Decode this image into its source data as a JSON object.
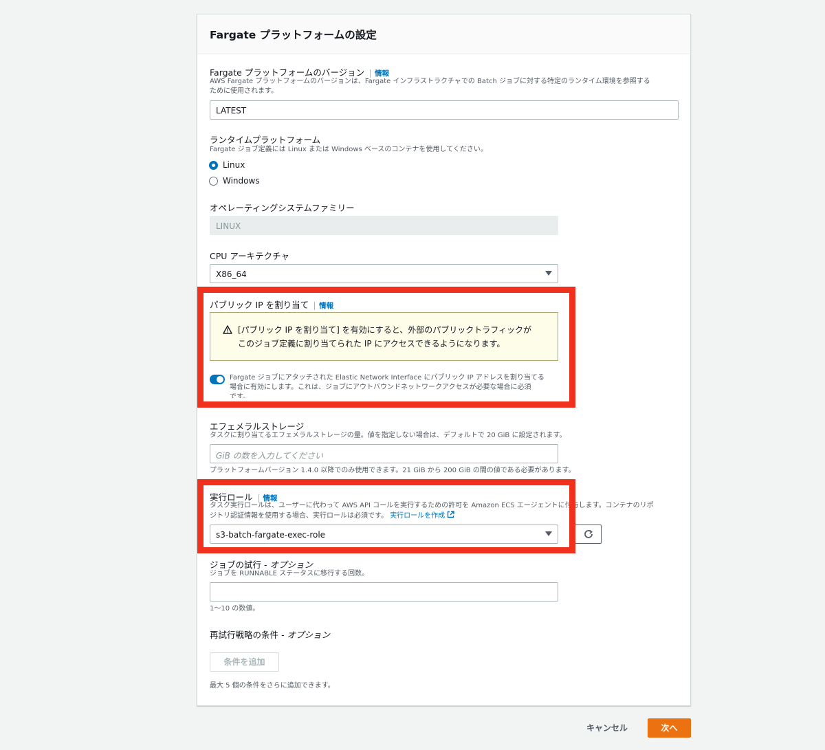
{
  "section": {
    "title": "Fargate プラットフォームの設定"
  },
  "info_label": "情報",
  "platform_version": {
    "label": "Fargate プラットフォームのバージョン",
    "description_line1": "AWS Fargate プラットフォームのバージョンは、Fargate インフラストラクチャでの Batch ジョブに対する特定のランタイム環境を参照する",
    "description_line2": "ために使用されます。",
    "value": "LATEST"
  },
  "runtime_platform": {
    "label": "ランタイムプラットフォーム",
    "description": "Fargate ジョブ定義には Linux または Windows ベースのコンテナを使用してください。",
    "options": [
      "Linux",
      "Windows"
    ],
    "selected": "Linux"
  },
  "os_family": {
    "label": "オペレーティングシステムファミリー",
    "value": "LINUX"
  },
  "cpu_arch": {
    "label": "CPU アーキテクチャ",
    "value": "X86_64"
  },
  "public_ip": {
    "label": "パブリック IP を割り当て",
    "alert_line1": "[パブリック IP を割り当て] を有効にすると、外部のパブリックトラフィックが",
    "alert_line2": "このジョブ定義に割り当てられた IP にアクセスできるようになります。",
    "toggle_line1": "Fargate ジョブにアタッチされた Elastic Network Interface にパブリック IP アドレスを割り当てる",
    "toggle_line2": "場合に有効にします。これは、ジョブにアウトバウンドネットワークアクセスが必要な場合に必須",
    "toggle_line3": "です。",
    "enabled": true
  },
  "ephemeral_storage": {
    "label": "エフェメラルストレージ",
    "description": "タスクに割り当てるエフェメラルストレージの量。値を指定しない場合は、デフォルトで 20 GiB に設定されます。",
    "placeholder": "GiB の数を入力してください",
    "constraint": "プラットフォームバージョン 1.4.0 以降でのみ使用できます。21 GiB から 200 GiB の間の値である必要があります。"
  },
  "execution_role": {
    "label": "実行ロール",
    "description_line1": "タスク実行ロールは、ユーザーに代わって AWS API コールを実行するための許可を Amazon ECS エージェントに付与します。コンテナのリポ",
    "description_line2": "ジトリ認証情報を使用する場合、実行ロールは必須です。",
    "create_link": "実行ロールを作成",
    "value": "s3-batch-fargate-exec-role"
  },
  "job_attempts": {
    "label": "ジョブの試行",
    "optional": " - オプション",
    "description": "ジョブを RUNNABLE ステータスに移行する回数。",
    "constraint": "1〜10 の数値。"
  },
  "retry_strategy": {
    "label": "再試行戦略の条件",
    "optional": " - オプション",
    "add_button": "条件を追加",
    "note": "最大 5 個の条件をさらに追加できます。"
  },
  "footer": {
    "cancel": "キャンセル",
    "next": "次へ"
  },
  "colors": {
    "highlight": "#f0311d",
    "primary": "#ec7211",
    "link": "#0073bb"
  }
}
